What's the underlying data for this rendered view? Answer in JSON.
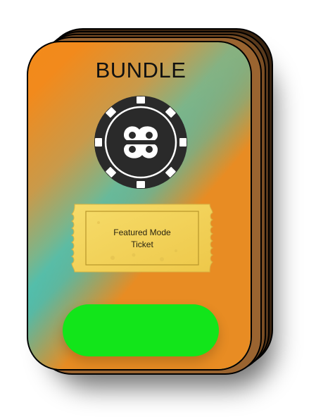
{
  "bundle": {
    "title": "BUNDLE",
    "chip_icon": "poker-chip-logo",
    "ticket": {
      "line1": "Featured Mode",
      "line2": "Ticket"
    },
    "colors": {
      "card_orange": "#f2891a",
      "card_teal": "#22c8cf",
      "button_green": "#12e51a",
      "ticket_gold": "#f2d65a",
      "chip_black": "#2a2a2a"
    }
  }
}
